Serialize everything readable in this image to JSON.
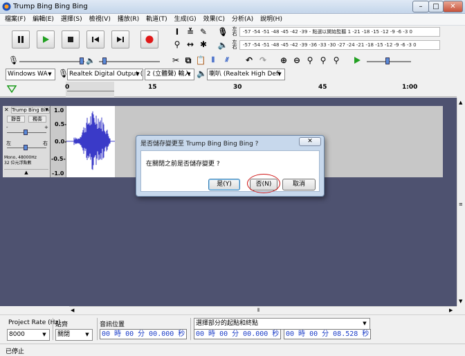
{
  "window": {
    "title": "Trump Bing Bing Bing",
    "minimize": "–",
    "maximize": "□",
    "close": "✕"
  },
  "menu": [
    "檔案(F)",
    "編輯(E)",
    "選擇(S)",
    "檢視(V)",
    "播放(R)",
    "軌道(T)",
    "生成(G)",
    "效果(C)",
    "分析(A)",
    "說明(H)"
  ],
  "meters": {
    "record": {
      "lr_top": "左",
      "lr_bottom": "右",
      "text": "-57 -54 -51 -48 -45 -42 -39 - 點選以開始監聽 1 -21 -18 -15 -12 -9 -6 -3 0"
    },
    "play": {
      "lr_top": "左",
      "lr_bottom": "右",
      "text": "-57 -54 -51 -48 -45 -42 -39 -36 -33 -30 -27 -24 -21 -18 -15 -12 -9 -6 -3 0"
    }
  },
  "devices": {
    "host": "Windows WA",
    "input": "Realtek Digital Output (",
    "channels": "2 (立體聲) 輸入",
    "output": "喇叭 (Realtek High Defi"
  },
  "ruler": {
    "labels": [
      "0",
      "15",
      "30",
      "45",
      "1:00"
    ]
  },
  "track": {
    "name": "Trump Bing Bing",
    "mute": "靜音",
    "solo": "獨奏",
    "gain_minus": "-",
    "gain_plus": "+",
    "pan_left": "左",
    "pan_right": "右",
    "info_line1": "Mono, 48000Hz",
    "info_line2": "32 位元浮點數",
    "scale": [
      "1.0",
      "0.5-",
      "0.0-",
      "-0.5-",
      "-1.0"
    ]
  },
  "dialog": {
    "title": "是否儲存變更至 Trump Bing Bing Bing ?",
    "message": "在關閉之前是否儲存變更 ?",
    "yes": "是(Y)",
    "no": "否(N)",
    "cancel": "取消"
  },
  "selection_toolbar": {
    "project_rate_label": "Project Rate (Hz)",
    "project_rate_value": "8000",
    "snap_label": "貼齊",
    "snap_value": "關閉",
    "audio_position_label": "音訊位置",
    "audio_position_value": "00 時 00 分 00.000 秒",
    "selection_mode_value": "選擇部分的起點和終點",
    "selection_start_value": "00 時 00 分 00.000 秒",
    "selection_end_value": "00 時 00 分 08.528 秒"
  },
  "status": "已停止"
}
